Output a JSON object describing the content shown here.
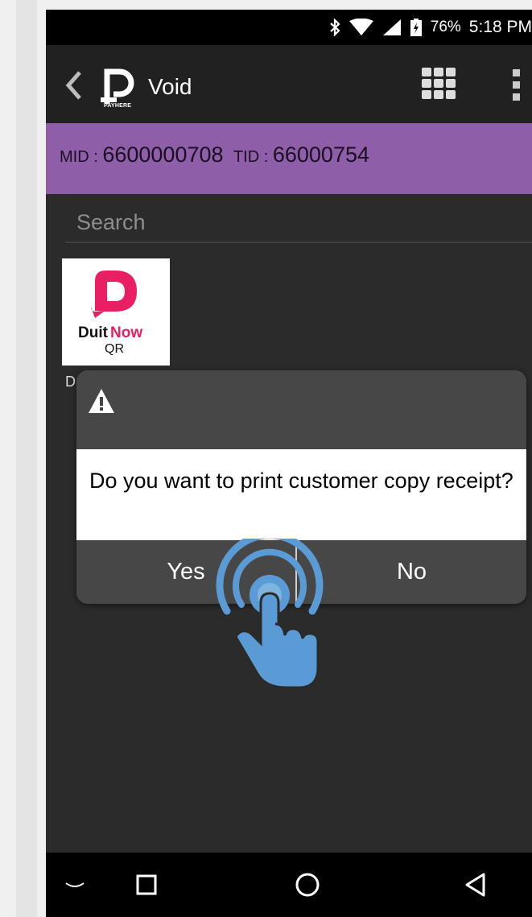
{
  "status_bar": {
    "battery": "76%",
    "time": "5:18 PM"
  },
  "app_bar": {
    "brand": "PAYHERE",
    "title": "Void"
  },
  "merchant": {
    "mid_label": "MID : ",
    "mid_value": "6600000708",
    "tid_label": "TID : ",
    "tid_value": "66000754"
  },
  "search": {
    "placeholder": "Search"
  },
  "tiles": [
    {
      "brand_a": "Duit",
      "brand_b": "Now",
      "sub": "QR",
      "label": "D",
      "colors": {
        "pink": "#e91e63"
      }
    }
  ],
  "dialog": {
    "message": "Do you want to print customer copy receipt?",
    "yes_label": "Yes",
    "no_label": "No"
  },
  "colors": {
    "accent": "#8e5ea9",
    "app_bar": "#212121",
    "dialog": "#474747",
    "tap_blue": "#5b9bd5"
  },
  "icons": [
    "back-icon",
    "payhere-logo",
    "grid-menu-icon",
    "more-vert-icon",
    "warning-icon",
    "tap-gesture-icon",
    "nav-down-icon",
    "nav-recents-icon",
    "nav-home-icon",
    "nav-back-icon"
  ]
}
